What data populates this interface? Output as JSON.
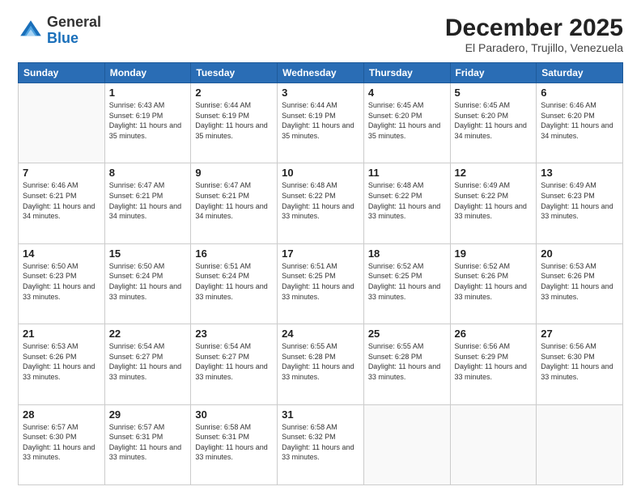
{
  "logo": {
    "general": "General",
    "blue": "Blue"
  },
  "header": {
    "month": "December 2025",
    "location": "El Paradero, Trujillo, Venezuela"
  },
  "weekdays": [
    "Sunday",
    "Monday",
    "Tuesday",
    "Wednesday",
    "Thursday",
    "Friday",
    "Saturday"
  ],
  "weeks": [
    [
      {
        "day": "",
        "sunrise": "",
        "sunset": "",
        "daylight": ""
      },
      {
        "day": "1",
        "sunrise": "Sunrise: 6:43 AM",
        "sunset": "Sunset: 6:19 PM",
        "daylight": "Daylight: 11 hours and 35 minutes."
      },
      {
        "day": "2",
        "sunrise": "Sunrise: 6:44 AM",
        "sunset": "Sunset: 6:19 PM",
        "daylight": "Daylight: 11 hours and 35 minutes."
      },
      {
        "day": "3",
        "sunrise": "Sunrise: 6:44 AM",
        "sunset": "Sunset: 6:19 PM",
        "daylight": "Daylight: 11 hours and 35 minutes."
      },
      {
        "day": "4",
        "sunrise": "Sunrise: 6:45 AM",
        "sunset": "Sunset: 6:20 PM",
        "daylight": "Daylight: 11 hours and 35 minutes."
      },
      {
        "day": "5",
        "sunrise": "Sunrise: 6:45 AM",
        "sunset": "Sunset: 6:20 PM",
        "daylight": "Daylight: 11 hours and 34 minutes."
      },
      {
        "day": "6",
        "sunrise": "Sunrise: 6:46 AM",
        "sunset": "Sunset: 6:20 PM",
        "daylight": "Daylight: 11 hours and 34 minutes."
      }
    ],
    [
      {
        "day": "7",
        "sunrise": "Sunrise: 6:46 AM",
        "sunset": "Sunset: 6:21 PM",
        "daylight": "Daylight: 11 hours and 34 minutes."
      },
      {
        "day": "8",
        "sunrise": "Sunrise: 6:47 AM",
        "sunset": "Sunset: 6:21 PM",
        "daylight": "Daylight: 11 hours and 34 minutes."
      },
      {
        "day": "9",
        "sunrise": "Sunrise: 6:47 AM",
        "sunset": "Sunset: 6:21 PM",
        "daylight": "Daylight: 11 hours and 34 minutes."
      },
      {
        "day": "10",
        "sunrise": "Sunrise: 6:48 AM",
        "sunset": "Sunset: 6:22 PM",
        "daylight": "Daylight: 11 hours and 33 minutes."
      },
      {
        "day": "11",
        "sunrise": "Sunrise: 6:48 AM",
        "sunset": "Sunset: 6:22 PM",
        "daylight": "Daylight: 11 hours and 33 minutes."
      },
      {
        "day": "12",
        "sunrise": "Sunrise: 6:49 AM",
        "sunset": "Sunset: 6:22 PM",
        "daylight": "Daylight: 11 hours and 33 minutes."
      },
      {
        "day": "13",
        "sunrise": "Sunrise: 6:49 AM",
        "sunset": "Sunset: 6:23 PM",
        "daylight": "Daylight: 11 hours and 33 minutes."
      }
    ],
    [
      {
        "day": "14",
        "sunrise": "Sunrise: 6:50 AM",
        "sunset": "Sunset: 6:23 PM",
        "daylight": "Daylight: 11 hours and 33 minutes."
      },
      {
        "day": "15",
        "sunrise": "Sunrise: 6:50 AM",
        "sunset": "Sunset: 6:24 PM",
        "daylight": "Daylight: 11 hours and 33 minutes."
      },
      {
        "day": "16",
        "sunrise": "Sunrise: 6:51 AM",
        "sunset": "Sunset: 6:24 PM",
        "daylight": "Daylight: 11 hours and 33 minutes."
      },
      {
        "day": "17",
        "sunrise": "Sunrise: 6:51 AM",
        "sunset": "Sunset: 6:25 PM",
        "daylight": "Daylight: 11 hours and 33 minutes."
      },
      {
        "day": "18",
        "sunrise": "Sunrise: 6:52 AM",
        "sunset": "Sunset: 6:25 PM",
        "daylight": "Daylight: 11 hours and 33 minutes."
      },
      {
        "day": "19",
        "sunrise": "Sunrise: 6:52 AM",
        "sunset": "Sunset: 6:26 PM",
        "daylight": "Daylight: 11 hours and 33 minutes."
      },
      {
        "day": "20",
        "sunrise": "Sunrise: 6:53 AM",
        "sunset": "Sunset: 6:26 PM",
        "daylight": "Daylight: 11 hours and 33 minutes."
      }
    ],
    [
      {
        "day": "21",
        "sunrise": "Sunrise: 6:53 AM",
        "sunset": "Sunset: 6:26 PM",
        "daylight": "Daylight: 11 hours and 33 minutes."
      },
      {
        "day": "22",
        "sunrise": "Sunrise: 6:54 AM",
        "sunset": "Sunset: 6:27 PM",
        "daylight": "Daylight: 11 hours and 33 minutes."
      },
      {
        "day": "23",
        "sunrise": "Sunrise: 6:54 AM",
        "sunset": "Sunset: 6:27 PM",
        "daylight": "Daylight: 11 hours and 33 minutes."
      },
      {
        "day": "24",
        "sunrise": "Sunrise: 6:55 AM",
        "sunset": "Sunset: 6:28 PM",
        "daylight": "Daylight: 11 hours and 33 minutes."
      },
      {
        "day": "25",
        "sunrise": "Sunrise: 6:55 AM",
        "sunset": "Sunset: 6:28 PM",
        "daylight": "Daylight: 11 hours and 33 minutes."
      },
      {
        "day": "26",
        "sunrise": "Sunrise: 6:56 AM",
        "sunset": "Sunset: 6:29 PM",
        "daylight": "Daylight: 11 hours and 33 minutes."
      },
      {
        "day": "27",
        "sunrise": "Sunrise: 6:56 AM",
        "sunset": "Sunset: 6:30 PM",
        "daylight": "Daylight: 11 hours and 33 minutes."
      }
    ],
    [
      {
        "day": "28",
        "sunrise": "Sunrise: 6:57 AM",
        "sunset": "Sunset: 6:30 PM",
        "daylight": "Daylight: 11 hours and 33 minutes."
      },
      {
        "day": "29",
        "sunrise": "Sunrise: 6:57 AM",
        "sunset": "Sunset: 6:31 PM",
        "daylight": "Daylight: 11 hours and 33 minutes."
      },
      {
        "day": "30",
        "sunrise": "Sunrise: 6:58 AM",
        "sunset": "Sunset: 6:31 PM",
        "daylight": "Daylight: 11 hours and 33 minutes."
      },
      {
        "day": "31",
        "sunrise": "Sunrise: 6:58 AM",
        "sunset": "Sunset: 6:32 PM",
        "daylight": "Daylight: 11 hours and 33 minutes."
      },
      {
        "day": "",
        "sunrise": "",
        "sunset": "",
        "daylight": ""
      },
      {
        "day": "",
        "sunrise": "",
        "sunset": "",
        "daylight": ""
      },
      {
        "day": "",
        "sunrise": "",
        "sunset": "",
        "daylight": ""
      }
    ]
  ]
}
